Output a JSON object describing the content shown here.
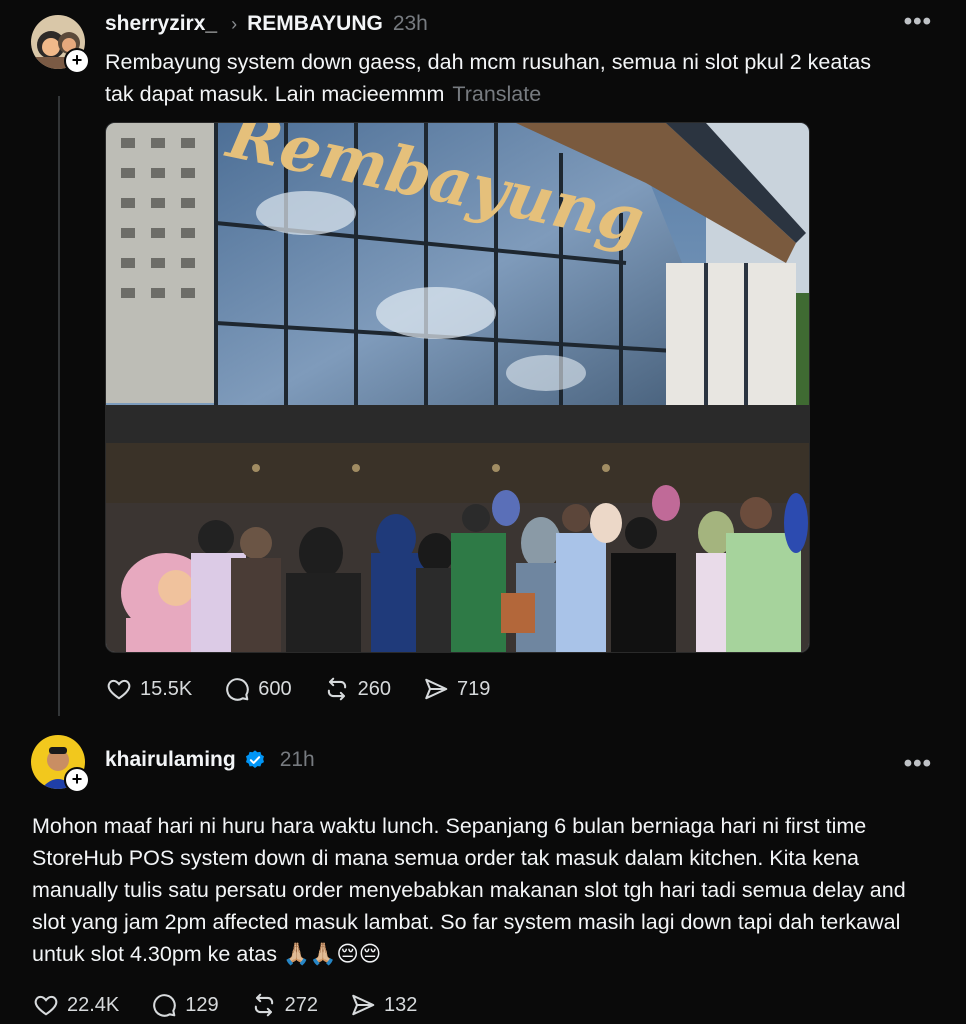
{
  "post1": {
    "username": "sherryzirx_",
    "topic": "REMBAYUNG",
    "time": "23h",
    "text": "Rembayung system down gaess, dah mcm rusuhan, semua ni slot pkul 2 keatas tak dapat masuk. Lain macieemmm",
    "translate_label": "Translate",
    "image_sign": "Rembayung",
    "likes": "15.5K",
    "replies": "600",
    "reposts": "260",
    "shares": "719"
  },
  "post2": {
    "username": "khairulaming",
    "time": "21h",
    "text": "Mohon maaf hari ni huru hara waktu lunch. Sepanjang 6 bulan berniaga hari ni first time StoreHub POS system down di mana semua order tak masuk dalam kitchen. Kita kena manually tulis satu persatu order menyebabkan makanan slot tgh hari tadi semua delay and slot yang jam 2pm affected masuk lambat. So far system masih lagi down tapi dah terkawal untuk slot 4.30pm ke atas 🙏🏼🙏🏼😔😔",
    "likes": "22.4K",
    "replies": "129",
    "reposts": "272",
    "shares": "132"
  },
  "colors": {
    "background": "#0a0a0a",
    "verified": "#0095f6",
    "muted": "#777b80"
  },
  "icons": [
    "heart-icon",
    "comment-icon",
    "repost-icon",
    "share-icon",
    "more-icon",
    "verified-icon",
    "follow-plus-icon"
  ]
}
